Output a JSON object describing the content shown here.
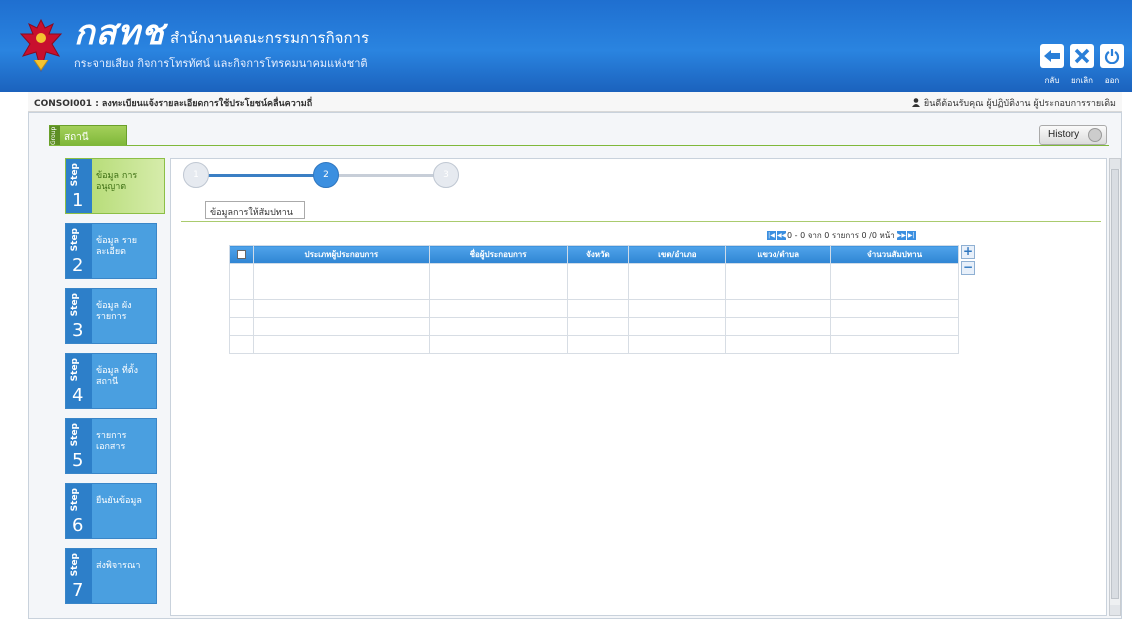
{
  "header": {
    "logo_abbr": "กสทช",
    "org_name": "สำนักงานคณะกรรมการกิจการ",
    "org_sub": "กระจายเสียง กิจการโทรทัศน์ และกิจการโทรคมนาคมแห่งชาติ",
    "buttons": [
      {
        "icon": "back-arrow-icon",
        "label": "กลับ"
      },
      {
        "icon": "close-icon",
        "label": "ยกเลิก"
      },
      {
        "icon": "power-icon",
        "label": "ออก"
      }
    ]
  },
  "topbar": {
    "form_title": "CONSOI001 : ลงทะเบียนแจ้งรายละเอียดการใช้ประโยชน์คลื่นความถี่",
    "welcome": "ยินดีต้อนรับคุณ ผู้ปฏิบัติงาน ผู้ประกอบการรายเดิม"
  },
  "group": {
    "vertical": "Group",
    "label": "สถานี"
  },
  "history": {
    "label": "History"
  },
  "steps": [
    {
      "word": "Step",
      "num": "1",
      "label": "ข้อมูล การอนุญาต",
      "active": true
    },
    {
      "word": "Step",
      "num": "2",
      "label": "ข้อมูล รายละเอียด",
      "active": false
    },
    {
      "word": "Step",
      "num": "3",
      "label": "ข้อมูล ผังรายการ",
      "active": false
    },
    {
      "word": "Step",
      "num": "4",
      "label": "ข้อมูล ที่ตั้งสถานี",
      "active": false
    },
    {
      "word": "Step",
      "num": "5",
      "label": "รายการ เอกสาร",
      "active": false
    },
    {
      "word": "Step",
      "num": "6",
      "label": "ยืนยันข้อมูล",
      "active": false
    },
    {
      "word": "Step",
      "num": "7",
      "label": "ส่งพิจารณา",
      "active": false
    }
  ],
  "progress": {
    "nodes": [
      "1",
      "2",
      "3"
    ],
    "current": "2"
  },
  "subtab": {
    "label": "ข้อมูลการให้สัมปทาน"
  },
  "pager": {
    "text": "0 - 0 จาก 0 รายการ  0  /0 หน้า"
  },
  "grid": {
    "columns": [
      "ประเภทผู้ประกอบการ",
      "ชื่อผู้ประกอบการ",
      "จังหวัด",
      "เขต/อำเภอ",
      "แขวง/ตำบล",
      "จำนวนสัมปทาน"
    ],
    "add_label": "+",
    "remove_label": "−"
  }
}
